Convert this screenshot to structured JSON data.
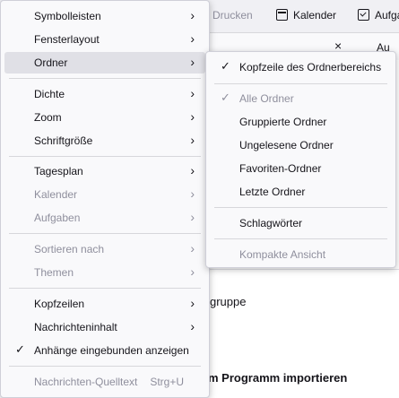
{
  "toolbar": {
    "print_label": "Drucken",
    "calendar_label": "Kalender",
    "tasks_label": "Aufga"
  },
  "background": {
    "close_glyph": "×",
    "partial_top_right": "Au",
    "group_text": "gruppe",
    "import_text": "m Programm importieren"
  },
  "main_menu": {
    "items": [
      {
        "label": "Symbolleisten"
      },
      {
        "label": "Fensterlayout"
      },
      {
        "label": "Ordner"
      },
      {
        "label": "Dichte"
      },
      {
        "label": "Zoom"
      },
      {
        "label": "Schriftgröße"
      },
      {
        "label": "Tagesplan"
      },
      {
        "label": "Kalender"
      },
      {
        "label": "Aufgaben"
      },
      {
        "label": "Sortieren nach"
      },
      {
        "label": "Themen"
      },
      {
        "label": "Kopfzeilen"
      },
      {
        "label": "Nachrichteninhalt"
      },
      {
        "label": "Anhänge eingebunden anzeigen"
      },
      {
        "label": "Nachrichten-Quelltext",
        "shortcut": "Strg+U"
      }
    ]
  },
  "folder_submenu": {
    "items": [
      {
        "label": "Kopfzeile des Ordnerbereichs"
      },
      {
        "label": "Alle Ordner"
      },
      {
        "label": "Gruppierte Ordner"
      },
      {
        "label": "Ungelesene Ordner"
      },
      {
        "label": "Favoriten-Ordner"
      },
      {
        "label": "Letzte Ordner"
      },
      {
        "label": "Schlagwörter"
      },
      {
        "label": "Kompakte Ansicht"
      }
    ]
  },
  "glyphs": {
    "chevron": "›",
    "check": "✓"
  }
}
